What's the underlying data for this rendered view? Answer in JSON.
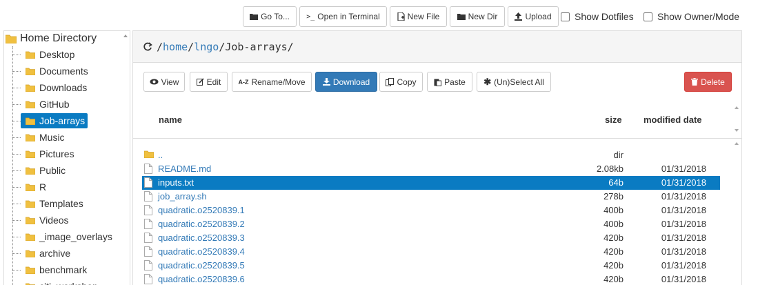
{
  "toolbar": {
    "goto_label": "Go To...",
    "terminal_label": "Open in Terminal",
    "new_file_label": "New File",
    "new_dir_label": "New Dir",
    "upload_label": "Upload",
    "show_dotfiles_label": "Show Dotfiles",
    "show_owner_label": "Show Owner/Mode"
  },
  "tree": {
    "root_label": "Home Directory",
    "items": [
      {
        "label": "Desktop"
      },
      {
        "label": "Documents"
      },
      {
        "label": "Downloads"
      },
      {
        "label": "GitHub"
      },
      {
        "label": "Job-arrays"
      },
      {
        "label": "Music"
      },
      {
        "label": "Pictures"
      },
      {
        "label": "Public"
      },
      {
        "label": "R"
      },
      {
        "label": "Templates"
      },
      {
        "label": "Videos"
      },
      {
        "label": "_image_overlays"
      },
      {
        "label": "archive"
      },
      {
        "label": "benchmark"
      },
      {
        "label": "citi_workshop"
      }
    ],
    "selected": "Job-arrays"
  },
  "path": {
    "segments": [
      "home",
      "lngo",
      "Job-arrays"
    ]
  },
  "actions": {
    "view_label": "View",
    "edit_label": "Edit",
    "rename_label": "Rename/Move",
    "download_label": "Download",
    "copy_label": "Copy",
    "paste_label": "Paste",
    "select_all_label": "(Un)Select All",
    "delete_label": "Delete"
  },
  "table": {
    "headers": {
      "name": "name",
      "size": "size",
      "modified": "modified date"
    },
    "rows": [
      {
        "name": "..",
        "size": "dir",
        "date": "",
        "type": "folder",
        "selected": false
      },
      {
        "name": "README.md",
        "size": "2.08kb",
        "date": "01/31/2018",
        "type": "file",
        "selected": false
      },
      {
        "name": "inputs.txt",
        "size": "64b",
        "date": "01/31/2018",
        "type": "file",
        "selected": true
      },
      {
        "name": "job_array.sh",
        "size": "278b",
        "date": "01/31/2018",
        "type": "file",
        "selected": false
      },
      {
        "name": "quadratic.o2520839.1",
        "size": "400b",
        "date": "01/31/2018",
        "type": "file",
        "selected": false
      },
      {
        "name": "quadratic.o2520839.2",
        "size": "400b",
        "date": "01/31/2018",
        "type": "file",
        "selected": false
      },
      {
        "name": "quadratic.o2520839.3",
        "size": "420b",
        "date": "01/31/2018",
        "type": "file",
        "selected": false
      },
      {
        "name": "quadratic.o2520839.4",
        "size": "420b",
        "date": "01/31/2018",
        "type": "file",
        "selected": false
      },
      {
        "name": "quadratic.o2520839.5",
        "size": "420b",
        "date": "01/31/2018",
        "type": "file",
        "selected": false
      },
      {
        "name": "quadratic.o2520839.6",
        "size": "420b",
        "date": "01/31/2018",
        "type": "file",
        "selected": false
      }
    ]
  },
  "colors": {
    "primary": "#337ab7",
    "danger": "#d9534f",
    "selection": "#0a7bc2",
    "folder": "#f0c040"
  }
}
